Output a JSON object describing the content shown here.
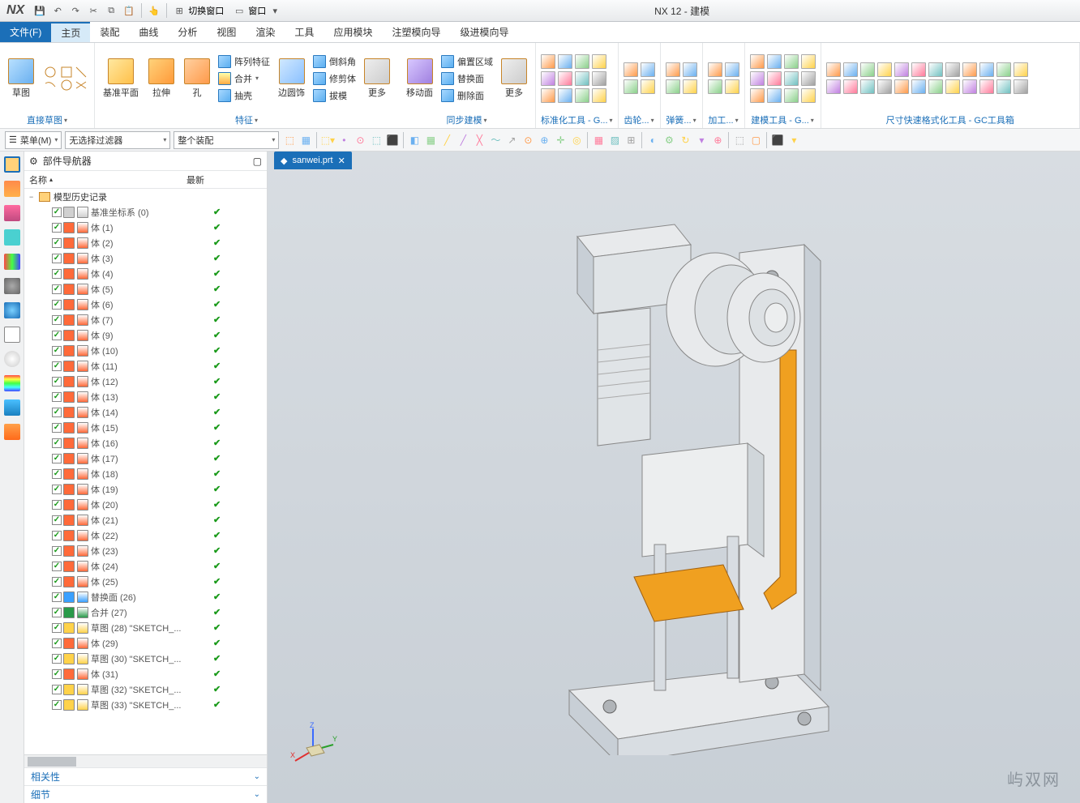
{
  "title": "NX 12 - 建模",
  "titlebar_items": [
    "切换窗口",
    "窗口"
  ],
  "menu": {
    "file": "文件(F)",
    "tabs": [
      "主页",
      "装配",
      "曲线",
      "分析",
      "视图",
      "渲染",
      "工具",
      "应用模块",
      "注塑模向导",
      "级进模向导"
    ],
    "active": 0
  },
  "ribbon": {
    "groups": [
      {
        "label": "直接草图",
        "big": [
          {
            "lb": "草图"
          }
        ]
      },
      {
        "label": "",
        "big": [
          {
            "lb": "基准平面"
          },
          {
            "lb": "拉伸"
          },
          {
            "lb": "孔"
          }
        ],
        "rows": [
          [
            "阵列特征",
            "合并",
            "抽壳"
          ]
        ]
      },
      {
        "label": "特征",
        "big": [
          {
            "lb": "边圆饰"
          }
        ],
        "rows": [
          [
            "倒斜角",
            "修剪体",
            "拔模"
          ]
        ]
      },
      {
        "label": "",
        "big": [
          {
            "lb": "更多"
          }
        ]
      },
      {
        "label": "同步建模",
        "big": [
          {
            "lb": "移动面"
          }
        ],
        "rows": [
          [
            "偏置区域",
            "替换面",
            "删除面"
          ]
        ]
      },
      {
        "label": "",
        "big": [
          {
            "lb": "更多"
          }
        ]
      },
      {
        "label": "标准化工具 - G..."
      },
      {
        "label": "齿轮..."
      },
      {
        "label": "弹簧..."
      },
      {
        "label": "加工..."
      },
      {
        "label": "建模工具 - G..."
      },
      {
        "label": "尺寸快速格式化工具 - GC工具箱"
      }
    ]
  },
  "selbar": {
    "menu_label": "菜单(M)",
    "filter1": "无选择过滤器",
    "filter2": "整个装配"
  },
  "nav": {
    "title": "部件导航器",
    "col1": "名称",
    "col2": "最新",
    "root": "模型历史记录",
    "items": [
      {
        "nm": "基准坐标系 (0)",
        "ic": "#d0d0d0"
      },
      {
        "nm": "体 (1)",
        "ic": "#ff6a3a"
      },
      {
        "nm": "体 (2)",
        "ic": "#ff6a3a"
      },
      {
        "nm": "体 (3)",
        "ic": "#ff6a3a"
      },
      {
        "nm": "体 (4)",
        "ic": "#ff6a3a"
      },
      {
        "nm": "体 (5)",
        "ic": "#ff6a3a"
      },
      {
        "nm": "体 (6)",
        "ic": "#ff6a3a"
      },
      {
        "nm": "体 (7)",
        "ic": "#ff6a3a"
      },
      {
        "nm": "体 (9)",
        "ic": "#ff6a3a"
      },
      {
        "nm": "体 (10)",
        "ic": "#ff6a3a"
      },
      {
        "nm": "体 (11)",
        "ic": "#ff6a3a"
      },
      {
        "nm": "体 (12)",
        "ic": "#ff6a3a"
      },
      {
        "nm": "体 (13)",
        "ic": "#ff6a3a"
      },
      {
        "nm": "体 (14)",
        "ic": "#ff6a3a"
      },
      {
        "nm": "体 (15)",
        "ic": "#ff6a3a"
      },
      {
        "nm": "体 (16)",
        "ic": "#ff6a3a"
      },
      {
        "nm": "体 (17)",
        "ic": "#ff6a3a"
      },
      {
        "nm": "体 (18)",
        "ic": "#ff6a3a"
      },
      {
        "nm": "体 (19)",
        "ic": "#ff6a3a"
      },
      {
        "nm": "体 (20)",
        "ic": "#ff6a3a"
      },
      {
        "nm": "体 (21)",
        "ic": "#ff6a3a"
      },
      {
        "nm": "体 (22)",
        "ic": "#ff6a3a"
      },
      {
        "nm": "体 (23)",
        "ic": "#ff6a3a"
      },
      {
        "nm": "体 (24)",
        "ic": "#ff6a3a"
      },
      {
        "nm": "体 (25)",
        "ic": "#ff6a3a"
      },
      {
        "nm": "替换面 (26)",
        "ic": "#3aa0ff"
      },
      {
        "nm": "合并 (27)",
        "ic": "#2a9a4a"
      },
      {
        "nm": "草图 (28) \"SKETCH_...",
        "ic": "#ffd24a"
      },
      {
        "nm": "体 (29)",
        "ic": "#ff6a3a"
      },
      {
        "nm": "草图 (30) \"SKETCH_...",
        "ic": "#ffd24a"
      },
      {
        "nm": "体 (31)",
        "ic": "#ff6a3a"
      },
      {
        "nm": "草图 (32) \"SKETCH_...",
        "ic": "#ffd24a"
      },
      {
        "nm": "草图 (33) \"SKETCH_...",
        "ic": "#ffd24a"
      }
    ],
    "sections": [
      "相关性",
      "细节"
    ]
  },
  "doc_tab": "sanwei.prt",
  "watermark": "屿双网",
  "triad": {
    "x": "X",
    "y": "Y",
    "z": "Z"
  }
}
